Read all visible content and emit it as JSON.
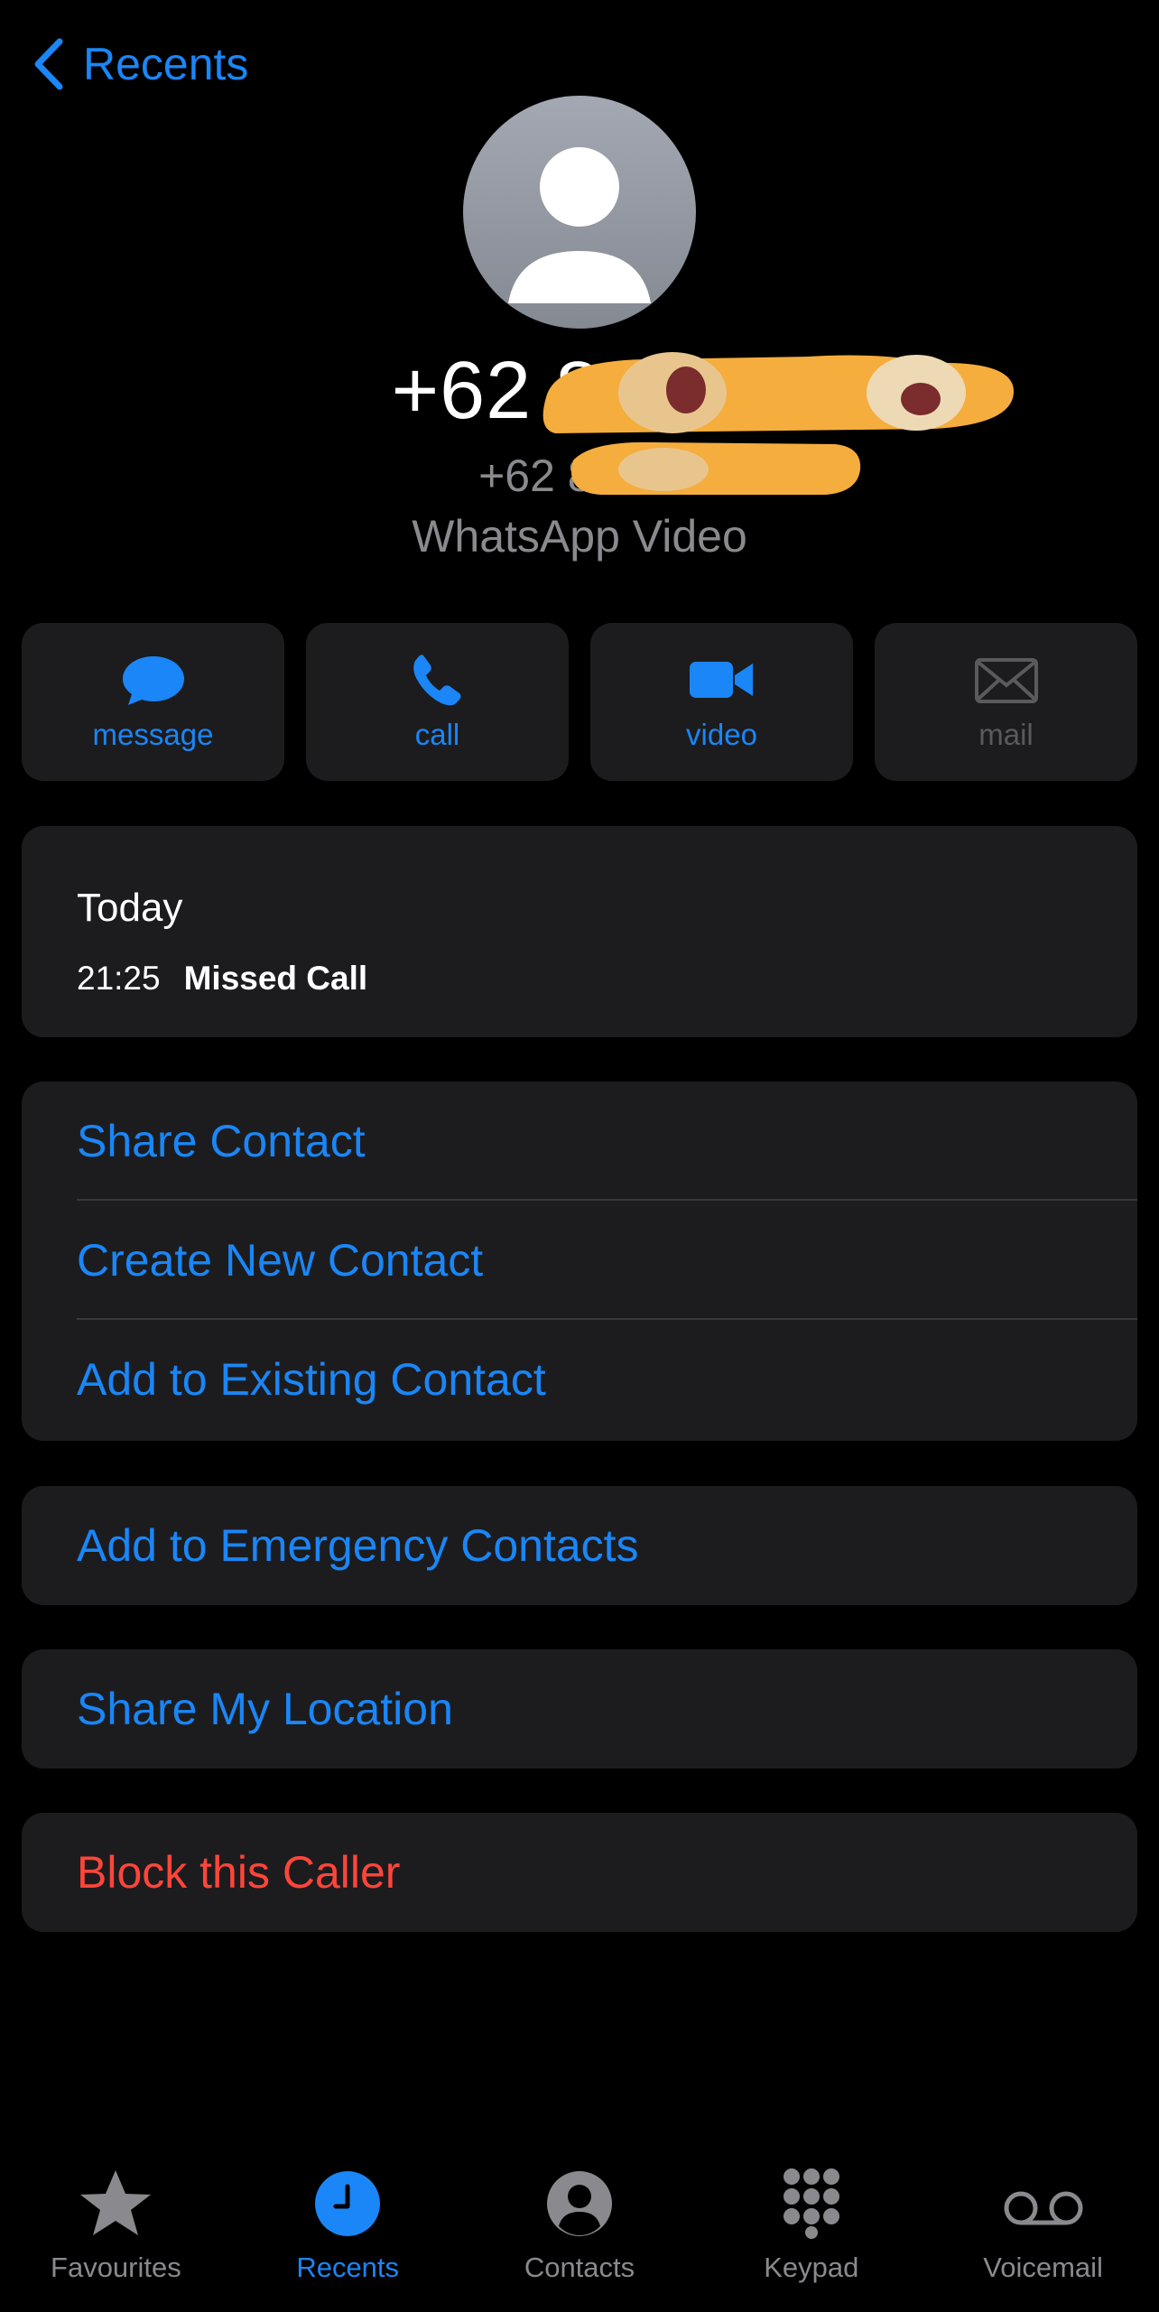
{
  "nav": {
    "back_label": "Recents"
  },
  "contact": {
    "number": "+62 882-2",
    "subnumber": "+62 882 2",
    "type_label": "WhatsApp Video"
  },
  "actions": [
    {
      "label": "message",
      "icon": "message-icon",
      "enabled": true
    },
    {
      "label": "call",
      "icon": "phone-icon",
      "enabled": true
    },
    {
      "label": "video",
      "icon": "video-icon",
      "enabled": true
    },
    {
      "label": "mail",
      "icon": "mail-icon",
      "enabled": false
    }
  ],
  "call_log": {
    "day": "Today",
    "entries": [
      {
        "time": "21:25",
        "status": "Missed Call"
      }
    ]
  },
  "contact_options": [
    "Share Contact",
    "Create New Contact",
    "Add to Existing Contact"
  ],
  "emergency": {
    "label": "Add to Emergency Contacts"
  },
  "location": {
    "label": "Share My Location"
  },
  "block": {
    "label": "Block this Caller"
  },
  "tabbar": {
    "items": [
      {
        "label": "Favourites",
        "icon": "star-icon",
        "active": false
      },
      {
        "label": "Recents",
        "icon": "clock-icon",
        "active": true
      },
      {
        "label": "Contacts",
        "icon": "person-circle-icon",
        "active": false
      },
      {
        "label": "Keypad",
        "icon": "keypad-icon",
        "active": false
      },
      {
        "label": "Voicemail",
        "icon": "voicemail-icon",
        "active": false
      }
    ]
  },
  "colors": {
    "accent": "#1a86f7",
    "destructive": "#ff453a",
    "card": "#1c1c1e",
    "secondary_text": "#8a8a8e"
  }
}
